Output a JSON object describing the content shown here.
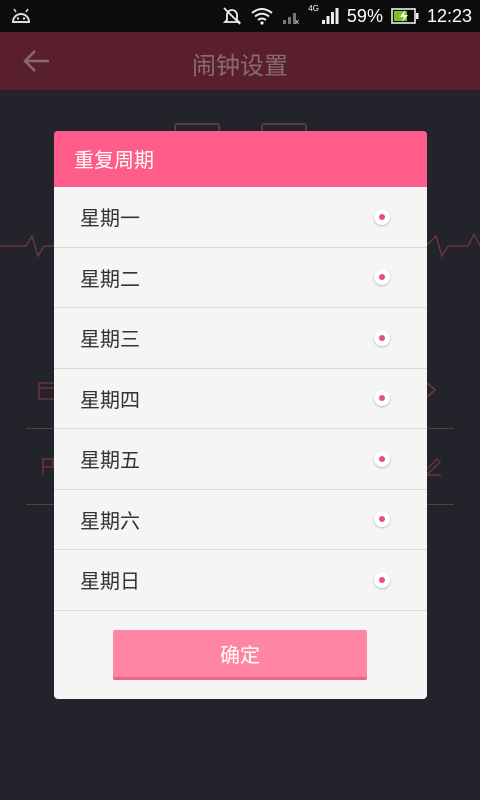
{
  "status_bar": {
    "battery_percent": "59%",
    "time": "12:23",
    "network_label": "4G"
  },
  "app_bar": {
    "title": "闹钟设置",
    "back_icon": "arrow-left-icon"
  },
  "dialog": {
    "title": "重复周期",
    "days": [
      {
        "label": "星期一"
      },
      {
        "label": "星期二"
      },
      {
        "label": "星期三"
      },
      {
        "label": "星期四"
      },
      {
        "label": "星期五"
      },
      {
        "label": "星期六"
      },
      {
        "label": "星期日"
      }
    ],
    "confirm_label": "确定"
  },
  "colors": {
    "accent": "#ff5c8a",
    "button": "#ff86a2",
    "dot": "#ec4d79",
    "background": "#22232b"
  }
}
